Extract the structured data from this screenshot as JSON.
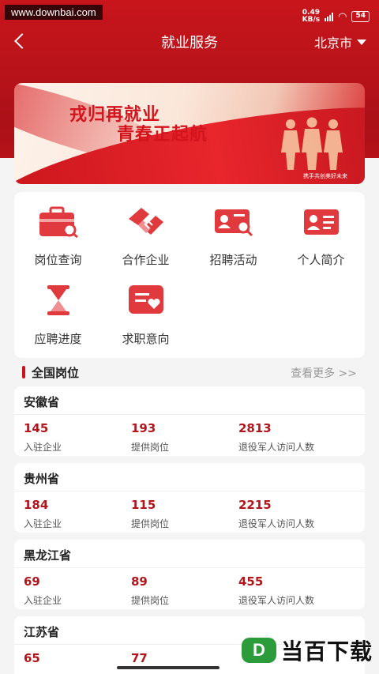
{
  "watermark": "www.downbai.com",
  "status": {
    "speed_value": "0.49",
    "speed_unit": "KB/s",
    "battery": "54"
  },
  "nav": {
    "title": "就业服务",
    "city": "北京市"
  },
  "banner": {
    "line1": "戎归再就业",
    "line2": "青春正起航",
    "caption": "携手共创美好未来"
  },
  "menu": [
    {
      "label": "岗位查询",
      "icon": "briefcase-search-icon"
    },
    {
      "label": "合作企业",
      "icon": "handshake-icon"
    },
    {
      "label": "招聘活动",
      "icon": "id-card-search-icon"
    },
    {
      "label": "个人简介",
      "icon": "profile-card-icon"
    },
    {
      "label": "应聘进度",
      "icon": "hourglass-icon"
    },
    {
      "label": "求职意向",
      "icon": "heart-message-icon"
    }
  ],
  "section": {
    "title": "全国岗位",
    "more": "查看更多 >>"
  },
  "stat_labels": {
    "companies": "入驻企业",
    "positions": "提供岗位",
    "visitors": "退役军人访问人数"
  },
  "provinces": [
    {
      "name": "安徽省",
      "companies": "145",
      "positions": "193",
      "visitors": "2813"
    },
    {
      "name": "贵州省",
      "companies": "184",
      "positions": "115",
      "visitors": "2215"
    },
    {
      "name": "黑龙江省",
      "companies": "69",
      "positions": "89",
      "visitors": "455"
    },
    {
      "name": "江苏省",
      "companies": "65",
      "positions": "77",
      "visitors": ""
    }
  ],
  "logo": {
    "badge": "D",
    "text": "当百下载"
  },
  "colors": {
    "brand_red": "#c8151b",
    "value_red": "#b3151c",
    "logo_green": "#2c9b3a"
  }
}
